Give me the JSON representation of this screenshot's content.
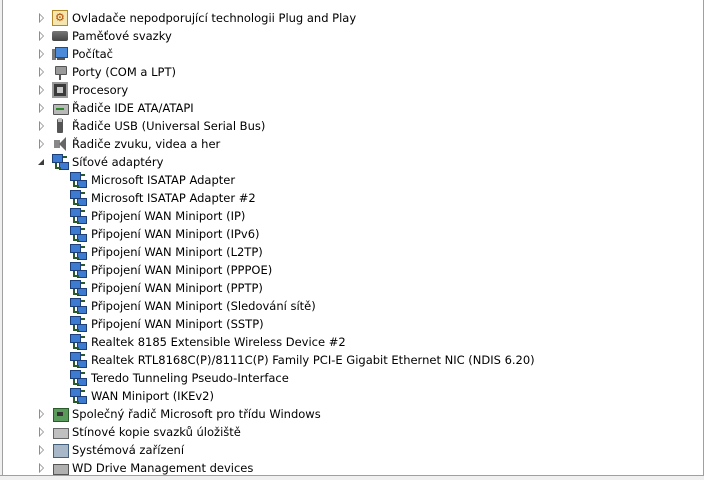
{
  "device_tree": {
    "categories_top": [
      {
        "label": "Ovladače nepodporující technologii Plug and Play",
        "icon": "plug-and-play-icon",
        "state": "collapsed"
      },
      {
        "label": "Paměťové svazky",
        "icon": "memory-volume-icon",
        "state": "collapsed"
      },
      {
        "label": "Počítač",
        "icon": "computer-icon",
        "state": "collapsed"
      },
      {
        "label": "Porty (COM a LPT)",
        "icon": "port-icon",
        "state": "collapsed"
      },
      {
        "label": "Procesory",
        "icon": "processor-icon",
        "state": "collapsed"
      },
      {
        "label": "Řadiče IDE ATA/ATAPI",
        "icon": "ide-controller-icon",
        "state": "collapsed"
      },
      {
        "label": "Řadiče USB (Universal Serial Bus)",
        "icon": "usb-icon",
        "state": "collapsed"
      },
      {
        "label": "Řadiče zvuku, videa a her",
        "icon": "speaker-icon",
        "state": "collapsed"
      },
      {
        "label": "Síťové adaptéry",
        "icon": "network-adapter-icon",
        "state": "expanded"
      }
    ],
    "network_adapters": [
      "Microsoft ISATAP Adapter",
      "Microsoft ISATAP Adapter #2",
      "Připojení WAN Miniport (IP)",
      "Připojení WAN Miniport (IPv6)",
      "Připojení WAN Miniport (L2TP)",
      "Připojení WAN Miniport (PPPOE)",
      "Připojení WAN Miniport (PPTP)",
      "Připojení WAN Miniport (Sledování sítě)",
      "Připojení WAN Miniport (SSTP)",
      "Realtek 8185 Extensible Wireless Device #2",
      "Realtek RTL8168C(P)/8111C(P) Family PCI-E Gigabit Ethernet NIC (NDIS 6.20)",
      "Teredo Tunneling Pseudo-Interface",
      "WAN Miniport (IKEv2)"
    ],
    "categories_bottom": [
      {
        "label": "Společný řadič Microsoft pro třídu Windows",
        "icon": "bus-controller-icon",
        "state": "collapsed"
      },
      {
        "label": "Stínové kopie svazků úložiště",
        "icon": "shadow-copy-icon",
        "state": "collapsed"
      },
      {
        "label": "Systémová zařízení",
        "icon": "system-device-icon",
        "state": "collapsed"
      },
      {
        "label": "WD Drive Management devices",
        "icon": "wd-drive-icon",
        "state": "collapsed"
      }
    ]
  }
}
